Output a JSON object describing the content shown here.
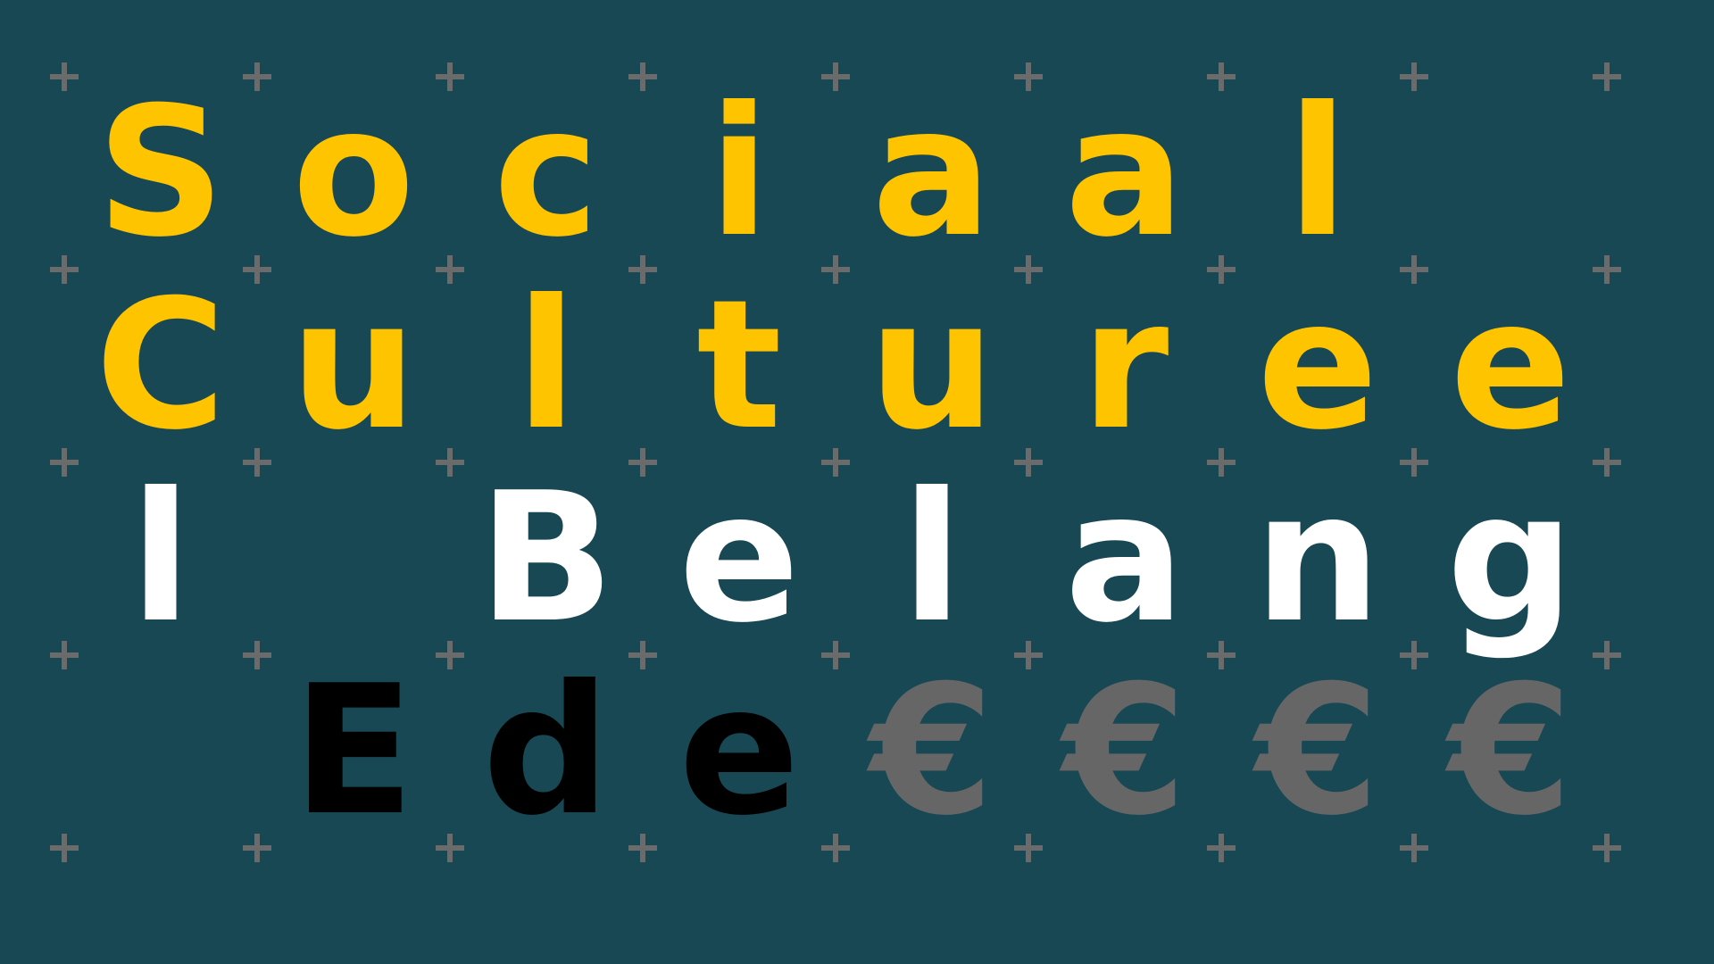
{
  "colors": {
    "background": "#194855",
    "plus": "#6b6b6b",
    "yellow": "#ffc400",
    "white": "#ffffff",
    "black": "#000000",
    "grey": "#666666"
  },
  "grid_icon": "plus-icon",
  "rows": [
    {
      "letters": [
        {
          "char": "S",
          "color": "yellow"
        },
        {
          "char": "o",
          "color": "yellow"
        },
        {
          "char": "c",
          "color": "yellow"
        },
        {
          "char": "i",
          "color": "yellow"
        },
        {
          "char": "a",
          "color": "yellow"
        },
        {
          "char": "a",
          "color": "yellow"
        },
        {
          "char": "l",
          "color": "yellow"
        },
        {
          "char": "",
          "color": "yellow"
        }
      ]
    },
    {
      "letters": [
        {
          "char": "C",
          "color": "yellow"
        },
        {
          "char": "u",
          "color": "yellow"
        },
        {
          "char": "l",
          "color": "yellow"
        },
        {
          "char": "t",
          "color": "yellow"
        },
        {
          "char": "u",
          "color": "yellow"
        },
        {
          "char": "r",
          "color": "yellow"
        },
        {
          "char": "e",
          "color": "yellow"
        },
        {
          "char": "e",
          "color": "yellow"
        }
      ]
    },
    {
      "letters": [
        {
          "char": "l",
          "color": "white"
        },
        {
          "char": "",
          "color": "white"
        },
        {
          "char": "B",
          "color": "white"
        },
        {
          "char": "e",
          "color": "white"
        },
        {
          "char": "l",
          "color": "white"
        },
        {
          "char": "a",
          "color": "white"
        },
        {
          "char": "n",
          "color": "white"
        },
        {
          "char": "g",
          "color": "white"
        }
      ]
    },
    {
      "letters": [
        {
          "char": "",
          "color": "black"
        },
        {
          "char": "E",
          "color": "black"
        },
        {
          "char": "d",
          "color": "black"
        },
        {
          "char": "e",
          "color": "black"
        },
        {
          "char": "€",
          "color": "grey"
        },
        {
          "char": "€",
          "color": "grey"
        },
        {
          "char": "€",
          "color": "grey"
        },
        {
          "char": "€",
          "color": "grey"
        }
      ]
    }
  ]
}
